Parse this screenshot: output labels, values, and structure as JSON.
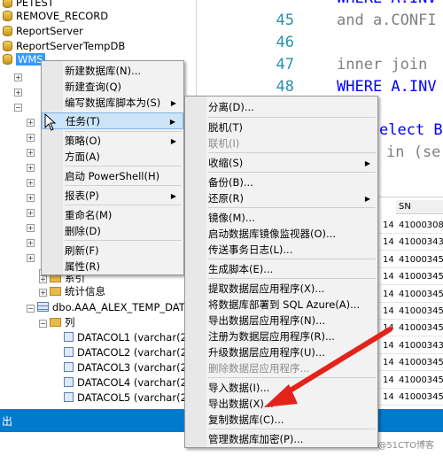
{
  "explorer": {
    "databases": [
      "PETEST",
      "REMOVE_RECORD",
      "ReportServer",
      "ReportServerTempDB",
      "WMS"
    ],
    "nodes": {
      "sys_partial": "系引",
      "stats": "统计信息",
      "table": "dbo.AAA_ALEX_TEMP_DATA",
      "columns_folder": "列"
    },
    "columns": [
      "DATACOL1 (varchar(20",
      "DATACOL2 (varchar(20",
      "DATACOL3 (varchar(20",
      "DATACOL4 (varchar(20",
      "DATACOL5 (varchar(20"
    ]
  },
  "editor": {
    "lines": [
      {
        "no": "45",
        "text": "and a.CONFI"
      },
      {
        "no": "46",
        "text": ""
      },
      {
        "no": "47",
        "text": "inner join"
      },
      {
        "no": "48",
        "text": "WHERE A.INV"
      }
    ],
    "line_top_partial": "WHERE A.INV",
    "select_text": "elect B",
    "in_text": "in (se"
  },
  "results": {
    "header_sn": "SN",
    "rows": [
      {
        "a": "14",
        "sn": "41000308"
      },
      {
        "a": "14",
        "sn": "41000343"
      },
      {
        "a": "14",
        "sn": "41000345"
      },
      {
        "a": "14",
        "sn": "41000345"
      },
      {
        "a": "14",
        "sn": "41000345"
      },
      {
        "a": "14",
        "sn": "41000345"
      },
      {
        "a": "14",
        "sn": "41000345"
      },
      {
        "a": "14",
        "sn": "41000343"
      },
      {
        "a": "14",
        "sn": "41000345"
      },
      {
        "a": "14",
        "sn": "41000345"
      },
      {
        "a": "14",
        "sn": "41000345"
      },
      {
        "a": "14",
        "sn": "41000345"
      }
    ]
  },
  "context_menu": {
    "items": [
      {
        "label": "新建数据库(N)...",
        "submenu": false
      },
      {
        "label": "新建查询(Q)",
        "submenu": false
      },
      {
        "label": "编写数据库脚本为(S)",
        "submenu": true
      },
      {
        "label": "任务(T)",
        "submenu": true,
        "highlighted": true
      },
      {
        "label": "策略(O)",
        "submenu": true
      },
      {
        "label": "方面(A)",
        "submenu": false
      },
      {
        "label": "启动 PowerShell(H)",
        "submenu": false
      },
      {
        "label": "报表(P)",
        "submenu": true
      },
      {
        "label": "重命名(M)",
        "submenu": false
      },
      {
        "label": "删除(D)",
        "submenu": false
      },
      {
        "label": "刷新(F)",
        "submenu": false
      },
      {
        "label": "属性(R)",
        "submenu": false
      }
    ]
  },
  "tasks_menu": {
    "items": [
      {
        "label": "分离(D)...",
        "submenu": false,
        "disabled": false
      },
      {
        "label": "脱机(T)",
        "submenu": false,
        "disabled": false
      },
      {
        "label": "联机(I)",
        "submenu": false,
        "disabled": true
      },
      {
        "label": "收缩(S)",
        "submenu": true,
        "disabled": false
      },
      {
        "label": "备份(B)...",
        "submenu": false,
        "disabled": false
      },
      {
        "label": "还原(R)",
        "submenu": true,
        "disabled": false
      },
      {
        "label": "镜像(M)...",
        "submenu": false,
        "disabled": false
      },
      {
        "label": "启动数据库镜像监视器(O)...",
        "submenu": false,
        "disabled": false
      },
      {
        "label": "传送事务日志(L)...",
        "submenu": false,
        "disabled": false
      },
      {
        "label": "生成脚本(E)...",
        "submenu": false,
        "disabled": false
      },
      {
        "label": "提取数据层应用程序(X)...",
        "submenu": false,
        "disabled": false
      },
      {
        "label": "将数据库部署到 SQL Azure(A)...",
        "submenu": false,
        "disabled": false
      },
      {
        "label": "导出数据层应用程序(N)...",
        "submenu": false,
        "disabled": false
      },
      {
        "label": "注册为数据层应用程序(R)...",
        "submenu": false,
        "disabled": false
      },
      {
        "label": "升级数据层应用程序(U)...",
        "submenu": false,
        "disabled": false
      },
      {
        "label": "删除数据层应用程序...",
        "submenu": false,
        "disabled": true
      },
      {
        "label": "导入数据(I)...",
        "submenu": false,
        "disabled": false
      },
      {
        "label": "导出数据(X)...",
        "submenu": false,
        "disabled": false
      },
      {
        "label": "复制数据库(C)...",
        "submenu": false,
        "disabled": false
      },
      {
        "label": "管理数据库加密(P)...",
        "submenu": false,
        "disabled": false
      }
    ]
  },
  "status": {
    "text": "出"
  },
  "watermark": "@51CTO博客",
  "colors": {
    "statusbar": "#007acc",
    "selection": "#3399ff",
    "arrow": "#e3231a",
    "keyword": "#0000ff",
    "line_number": "#2b91af"
  }
}
